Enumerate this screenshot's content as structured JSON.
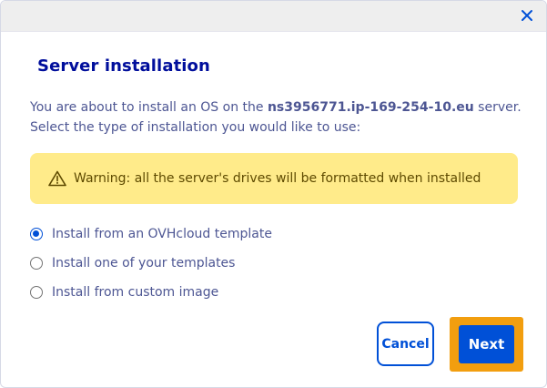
{
  "dialog": {
    "title": "Server installation",
    "description_prefix": "You are about to install an OS on the ",
    "hostname": "ns3956771.ip-169-254-10.eu",
    "description_suffix": " server.",
    "description_line2": "Select the type of installation you would like to use:",
    "warning": "Warning: all the server's drives will be formatted when installed",
    "options": [
      {
        "label": "Install from an OVHcloud template",
        "selected": true
      },
      {
        "label": "Install one of your templates",
        "selected": false
      },
      {
        "label": "Install from custom image",
        "selected": false
      }
    ],
    "cancel_label": "Cancel",
    "next_label": "Next"
  },
  "icons": {
    "close": "close-icon",
    "warning": "warning-triangle-icon"
  },
  "colors": {
    "primary": "#0050d7",
    "title": "#000e9c",
    "text": "#4d5693",
    "warning_bg": "#ffeb8a",
    "focus_ring": "#f29e0f"
  }
}
